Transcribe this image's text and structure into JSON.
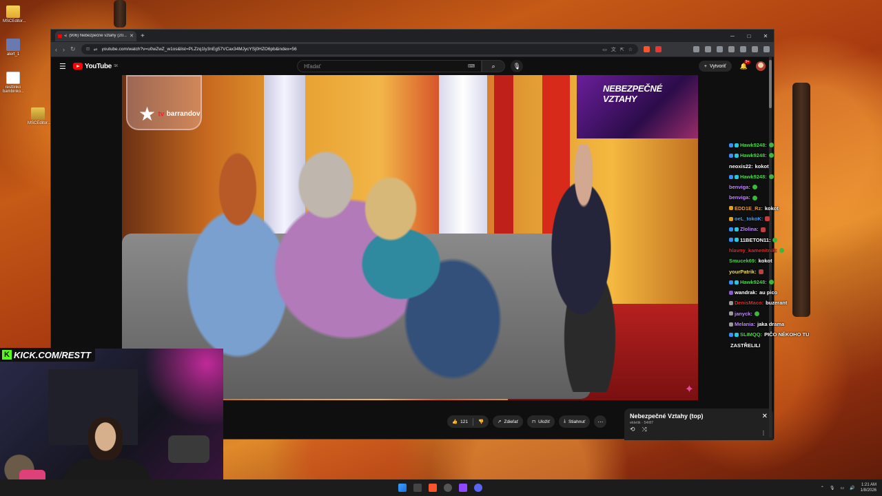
{
  "desktop": {
    "icons": [
      {
        "label": "MSCEditor...",
        "type": "folder"
      },
      {
        "label": "alert_1",
        "type": "person"
      },
      {
        "label": "resttinko bambinko...",
        "type": "file"
      },
      {
        "label": "MSCEditor...",
        "type": "zip"
      }
    ]
  },
  "browser": {
    "tab_title": "(906) Nebezpečné vztahy (20...",
    "url": "youtube.com/watch?v=u0wZwZ_w1os&list=PLZzq1ly3nEg57VCax34MJycYSj0HZO6pb&index=56"
  },
  "youtube": {
    "logo": "YouTube",
    "region": "SK",
    "search_placeholder": "Hľadať",
    "create_label": "Vytvoriť",
    "notif_count": "9+",
    "video": {
      "channel_logo_text": "barrandov",
      "channel_tv": "tv",
      "screen_text": "NEBEZPEČNÉ VZTAHY"
    },
    "actions": {
      "likes": "121",
      "share": "Zdieľať",
      "save": "Uložiť",
      "download": "Stiahnuť"
    },
    "playlist": {
      "title": "Nebezpečné Vztahy (top)",
      "subtitle": "ekletik · 54/87"
    }
  },
  "chat": [
    {
      "user": "Hawk9248:",
      "color": "#4fd64f",
      "badges": [
        "blue",
        "cyan"
      ],
      "text": "",
      "emote": "g"
    },
    {
      "user": "Hawk9248:",
      "color": "#4fd64f",
      "badges": [
        "blue",
        "cyan"
      ],
      "text": "",
      "emote": "g"
    },
    {
      "user": "neoxis22:",
      "color": "#ffffff",
      "badges": [],
      "text": "kokot",
      "emote": ""
    },
    {
      "user": "Hawk9248:",
      "color": "#4fd64f",
      "badges": [
        "blue",
        "cyan"
      ],
      "text": "",
      "emote": "g"
    },
    {
      "user": "benviga:",
      "color": "#c48aff",
      "badges": [],
      "text": "",
      "emote": "g"
    },
    {
      "user": "benviga:",
      "color": "#c48aff",
      "badges": [],
      "text": "",
      "emote": "g"
    },
    {
      "user": "EDD1E_Rz:",
      "color": "#e0a030",
      "badges": [
        "gold"
      ],
      "text": "kokot",
      "emote": ""
    },
    {
      "user": "oeL_tokoK:",
      "color": "#3aa0ff",
      "badges": [
        "gold"
      ],
      "text": "",
      "emote": "r"
    },
    {
      "user": "Zlolina:",
      "color": "#c48aff",
      "badges": [
        "blue",
        "cyan"
      ],
      "text": "",
      "emote": "r"
    },
    {
      "user": "11BETON11:",
      "color": "#ffffff",
      "badges": [
        "blue",
        "cyan"
      ],
      "text": "",
      "emote": "g"
    },
    {
      "user": "hlavny_kamenitnik:",
      "color": "#d63030",
      "badges": [],
      "text": "",
      "emote": "g"
    },
    {
      "user": "Smucek69:",
      "color": "#4fd64f",
      "badges": [],
      "text": "kokot",
      "emote": ""
    },
    {
      "user": "yourPatrik:",
      "color": "#f0e040",
      "badges": [],
      "text": "",
      "emote": "r"
    },
    {
      "user": "Hawk9248:",
      "color": "#4fd64f",
      "badges": [
        "blue",
        "cyan"
      ],
      "text": "",
      "emote": "g"
    },
    {
      "user": "wandrak:",
      "color": "#ffffff",
      "badges": [
        "purple"
      ],
      "text": "au pico",
      "emote": ""
    },
    {
      "user": "DenisMaco:",
      "color": "#d63030",
      "badges": [
        "gray"
      ],
      "text": "buzerant",
      "emote": ""
    },
    {
      "user": "janyck:",
      "color": "#c48aff",
      "badges": [
        "gray"
      ],
      "text": "",
      "emote": "g"
    },
    {
      "user": "Melania:",
      "color": "#c48aff",
      "badges": [
        "gray"
      ],
      "text": "jaka drama",
      "emote": ""
    },
    {
      "user": "SLIMQQ:",
      "color": "#4fd64f",
      "badges": [
        "blue",
        "cyan"
      ],
      "text": "PIČO NĚKOHO TU",
      "emote": ""
    },
    {
      "user": "",
      "color": "#ffffff",
      "badges": [],
      "text": "ZASTŘELILI",
      "emote": ""
    }
  ],
  "overlay": {
    "kick_url": "KICK.COM/RESTT"
  },
  "taskbar": {
    "time": "1:21 AM",
    "date": "1/8/2026"
  }
}
